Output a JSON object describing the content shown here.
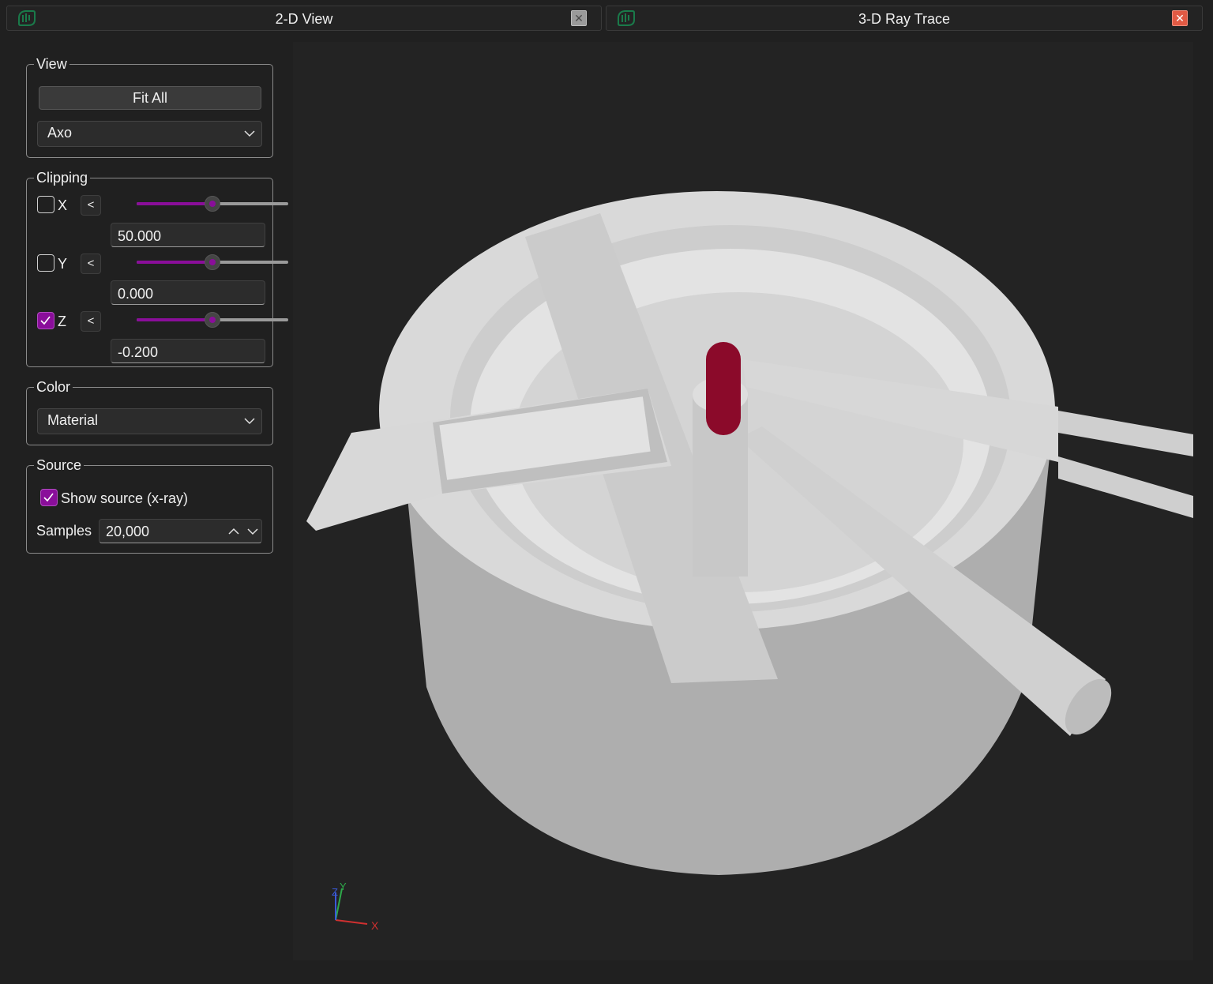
{
  "tabs": [
    {
      "title": "2-D View",
      "close_icon": "close-icon",
      "active": false
    },
    {
      "title": "3-D Ray Trace",
      "close_icon": "close-icon",
      "active": true
    }
  ],
  "view": {
    "group_title": "View",
    "fit_all_label": "Fit All",
    "projection_value": "Axo"
  },
  "clipping": {
    "group_title": "Clipping",
    "axes": [
      {
        "label": "X",
        "checked": false,
        "direction": "<",
        "slider_fraction": 0.5,
        "value": "50.000"
      },
      {
        "label": "Y",
        "checked": false,
        "direction": "<",
        "slider_fraction": 0.5,
        "value": "0.000"
      },
      {
        "label": "Z",
        "checked": true,
        "direction": "<",
        "slider_fraction": 0.5,
        "value": "-0.200"
      }
    ]
  },
  "color": {
    "group_title": "Color",
    "mode_value": "Material"
  },
  "source": {
    "group_title": "Source",
    "show_source_label": "Show source (x-ray)",
    "show_source_checked": true,
    "samples_label": "Samples",
    "samples_value": "20,000"
  },
  "axis_triad": {
    "x": "X",
    "y": "Y",
    "z": "Z"
  },
  "colors": {
    "accent": "#8a0e9a",
    "source_marker": "#8b0a2a",
    "model_gray": "#d6d6d6",
    "close_active": "#e25a44",
    "logo_green": "#1a7a4a"
  }
}
